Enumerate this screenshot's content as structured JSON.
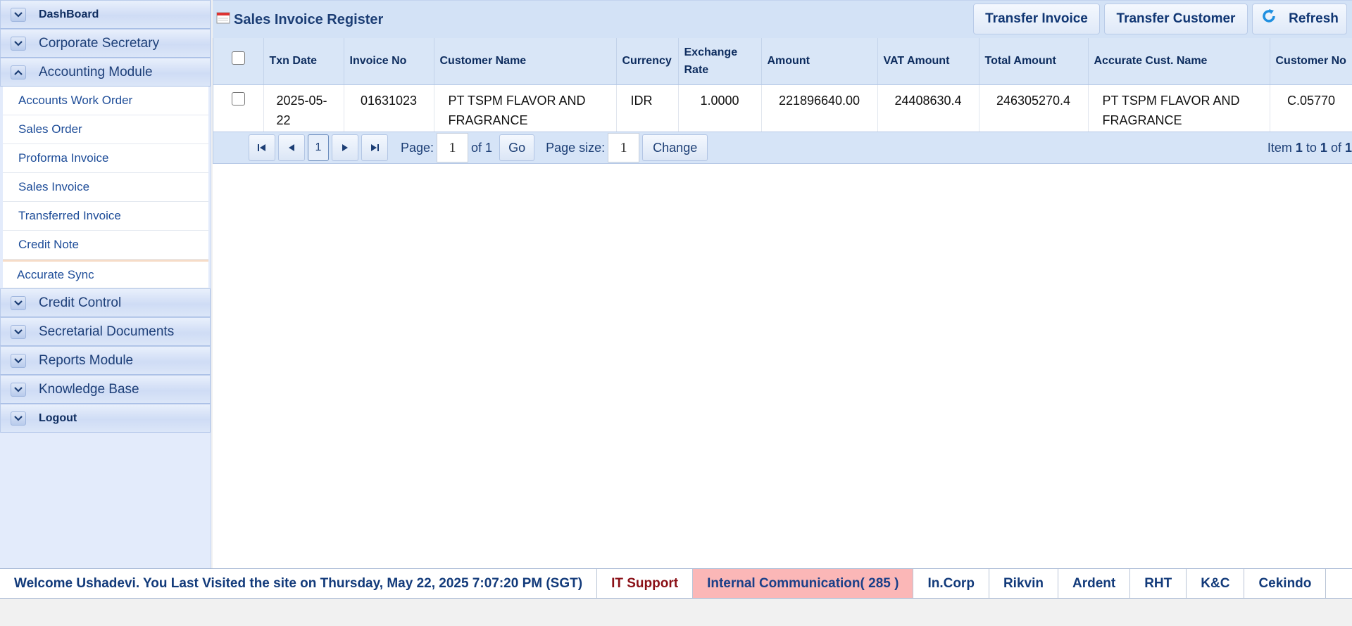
{
  "sidebar": {
    "headers_top": [
      {
        "label": "DashBoard",
        "expanded": false
      },
      {
        "label": "Corporate Secretary",
        "expanded": false
      },
      {
        "label": "Accounting Module",
        "expanded": true
      }
    ],
    "accounting_items": [
      {
        "label": "Accounts Work Order"
      },
      {
        "label": "Sales Order"
      },
      {
        "label": "Proforma Invoice"
      },
      {
        "label": "Sales Invoice"
      },
      {
        "label": "Transferred Invoice"
      },
      {
        "label": "Credit Note"
      },
      {
        "label": "Accurate Sync"
      }
    ],
    "headers_bottom": [
      {
        "label": "Credit Control"
      },
      {
        "label": "Secretarial Documents"
      },
      {
        "label": "Reports Module"
      },
      {
        "label": "Knowledge Base"
      },
      {
        "label": "Logout"
      }
    ]
  },
  "toolbar": {
    "title": "Sales Invoice Register",
    "transfer_invoice": "Transfer Invoice",
    "transfer_customer": "Transfer Customer",
    "refresh": "Refresh"
  },
  "grid": {
    "columns": [
      "Txn Date",
      "Invoice No",
      "Customer Name",
      "Currency",
      "Exchange Rate",
      "Amount",
      "VAT Amount",
      "Total Amount",
      "Accurate Cust. Name",
      "Customer No"
    ],
    "rows": [
      {
        "txn_date": "2025-05-22",
        "invoice_no": "01631023",
        "customer_name": "PT TSPM FLAVOR AND FRAGRANCE",
        "currency": "IDR",
        "exchange_rate": "1.0000",
        "amount": "221896640.00",
        "vat_amount": "24408630.4",
        "total_amount": "246305270.4",
        "accurate_cust_name": "PT TSPM FLAVOR AND FRAGRANCE",
        "customer_no": "C.05770"
      }
    ]
  },
  "pager": {
    "current_page": "1",
    "page_label": "Page:",
    "page_value": "1",
    "of_label": "of 1",
    "go_label": "Go",
    "page_size_label": "Page size:",
    "page_size_value": "1",
    "change_label": "Change",
    "item_label": "Item",
    "item_from": "1",
    "to_label": "to",
    "item_to": "1",
    "of_total_label": "of",
    "item_total": "1"
  },
  "footer": {
    "welcome": "Welcome Ushadevi. You Last Visited the site on Thursday, May 22, 2025 7:07:20 PM (SGT)",
    "it_support": "IT Support",
    "internal_comm": "Internal Communication( 285 )",
    "links": [
      "In.Corp",
      "Rikvin",
      "Ardent",
      "RHT",
      "K&C",
      "Cekindo"
    ]
  },
  "colors": {
    "sidebar_bg": "#e3ebfb",
    "header_bg": "#d3e2f6",
    "accent": "#1c3e75",
    "it_support": "#8a0f16",
    "internal_comm_bg": "#fbb7b7"
  }
}
